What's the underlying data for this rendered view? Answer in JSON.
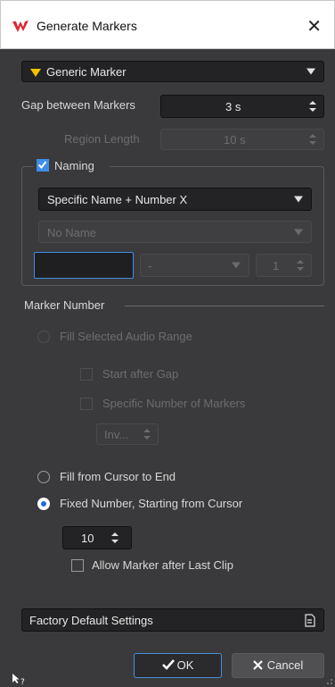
{
  "window": {
    "title": "Generate Markers",
    "close_glyph": "✕"
  },
  "marker_type": {
    "value": "Generic Marker",
    "icon": "triangle-down-yellow",
    "icon_color": "#f2c200"
  },
  "gap": {
    "label": "Gap between Markers",
    "value": "3 s"
  },
  "region": {
    "label": "Region Length",
    "value": "10 s"
  },
  "naming": {
    "label": "Naming",
    "checked": true,
    "mode": "Specific Name + Number X",
    "name": "No Name",
    "prefix": "",
    "separator": "-",
    "number": "1"
  },
  "marker_number": {
    "label": "Marker Number",
    "fill_selected": "Fill Selected Audio Range",
    "start_after_gap": "Start after Gap",
    "specific_number": "Specific Number of Markers",
    "inv_value": "Inv...",
    "fill_cursor": "Fill from Cursor to End",
    "fixed_number": "Fixed Number, Starting from Cursor",
    "fixed_value": "10",
    "allow_after_clip": "Allow Marker after Last Clip"
  },
  "presets": {
    "label": "Factory Default Settings"
  },
  "actions": {
    "ok": "OK",
    "cancel": "Cancel"
  },
  "colors": {
    "accent": "#1c6fd6",
    "ok_border": "#4a90d9"
  }
}
